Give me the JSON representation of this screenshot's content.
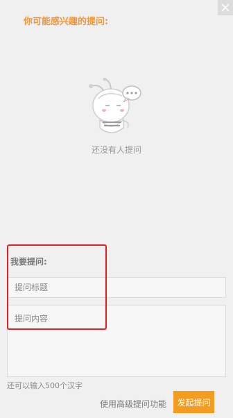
{
  "header": {
    "section_title": "你可能感兴趣的提问:",
    "close_icon": "close-icon"
  },
  "empty_state": {
    "illustration": "mascot-with-speech-bubble-illustration",
    "message": "还没有人提问"
  },
  "ask_form": {
    "title": "我要提问:",
    "title_placeholder": "提问标题",
    "content_placeholder": "提问内容",
    "char_hint": "还可以输入500个汉字",
    "advanced_link": "使用高级提问功能",
    "submit_label": "发起提问"
  },
  "colors": {
    "accent_orange": "#f0963a",
    "button_orange": "#f39c1d",
    "highlight_red": "#e02020",
    "background": "#f0f0f0"
  }
}
